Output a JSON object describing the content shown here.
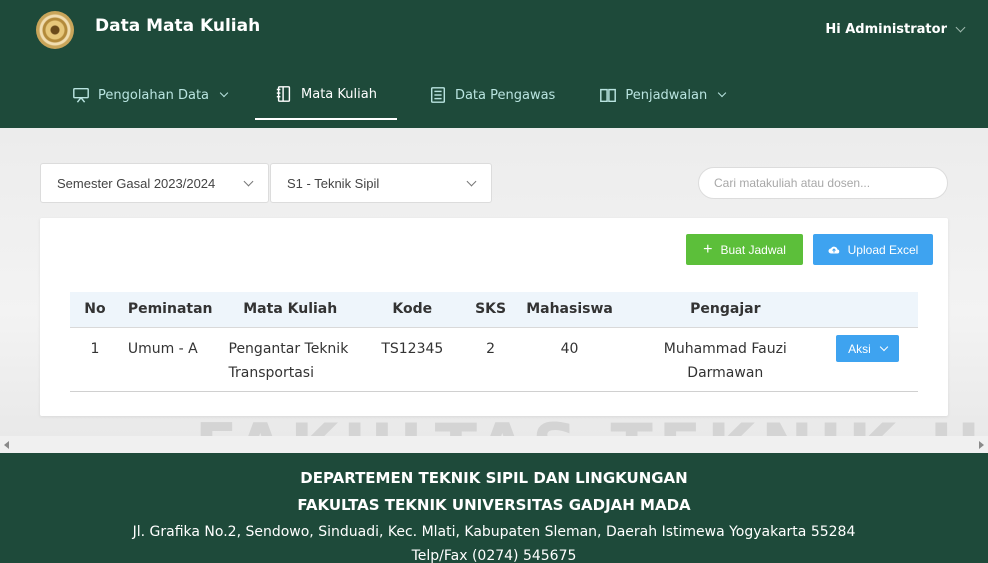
{
  "header": {
    "title": "Data Mata Kuliah",
    "user_greeting": "Hi Administrator",
    "logo_icon": "ugm-seal"
  },
  "nav": [
    {
      "label": "Pengolahan Data",
      "icon": "presentation-board-icon",
      "dropdown": true
    },
    {
      "label": "Mata Kuliah",
      "icon": "notebook-icon",
      "active": true
    },
    {
      "label": "Data Pengawas",
      "icon": "document-list-icon"
    },
    {
      "label": "Penjadwalan",
      "icon": "open-book-icon",
      "dropdown": true
    }
  ],
  "filters": {
    "semester": "Semester Gasal 2023/2024",
    "program": "S1 - Teknik Sipil",
    "search_placeholder": "Cari matakuliah atau dosen..."
  },
  "actions": {
    "create_label": "Buat Jadwal",
    "upload_label": "Upload Excel"
  },
  "table": {
    "headers": [
      "No",
      "Peminatan",
      "Mata Kuliah",
      "Kode",
      "SKS",
      "Mahasiswa",
      "Pengajar"
    ],
    "rows": [
      {
        "no": "1",
        "peminatan": "Umum - A",
        "mata_kuliah": "Pengantar Teknik Transportasi",
        "kode": "TS12345",
        "sks": "2",
        "mahasiswa": "40",
        "pengajar": "Muhammad Fauzi Darmawan",
        "action_label": "Aksi"
      }
    ]
  },
  "background_text": "FAKULTAS TEKNIK UGM",
  "footer": {
    "line1": "DEPARTEMEN TEKNIK SIPIL DAN LINGKUNGAN",
    "line2": "FAKULTAS TEKNIK UNIVERSITAS GADJAH MADA",
    "line3": "Jl. Grafika No.2, Sendowo, Sinduadi, Kec. Mlati, Kabupaten Sleman, Daerah Istimewa Yogyakarta 55284",
    "line4": "Telp/Fax (0274) 545675"
  },
  "colors": {
    "primary": "#1e4a3a",
    "nav_text": "#b9e4e0",
    "green_button": "#5cbf3a",
    "blue_button": "#3ea3f0",
    "table_header_bg": "#eef5fb"
  }
}
